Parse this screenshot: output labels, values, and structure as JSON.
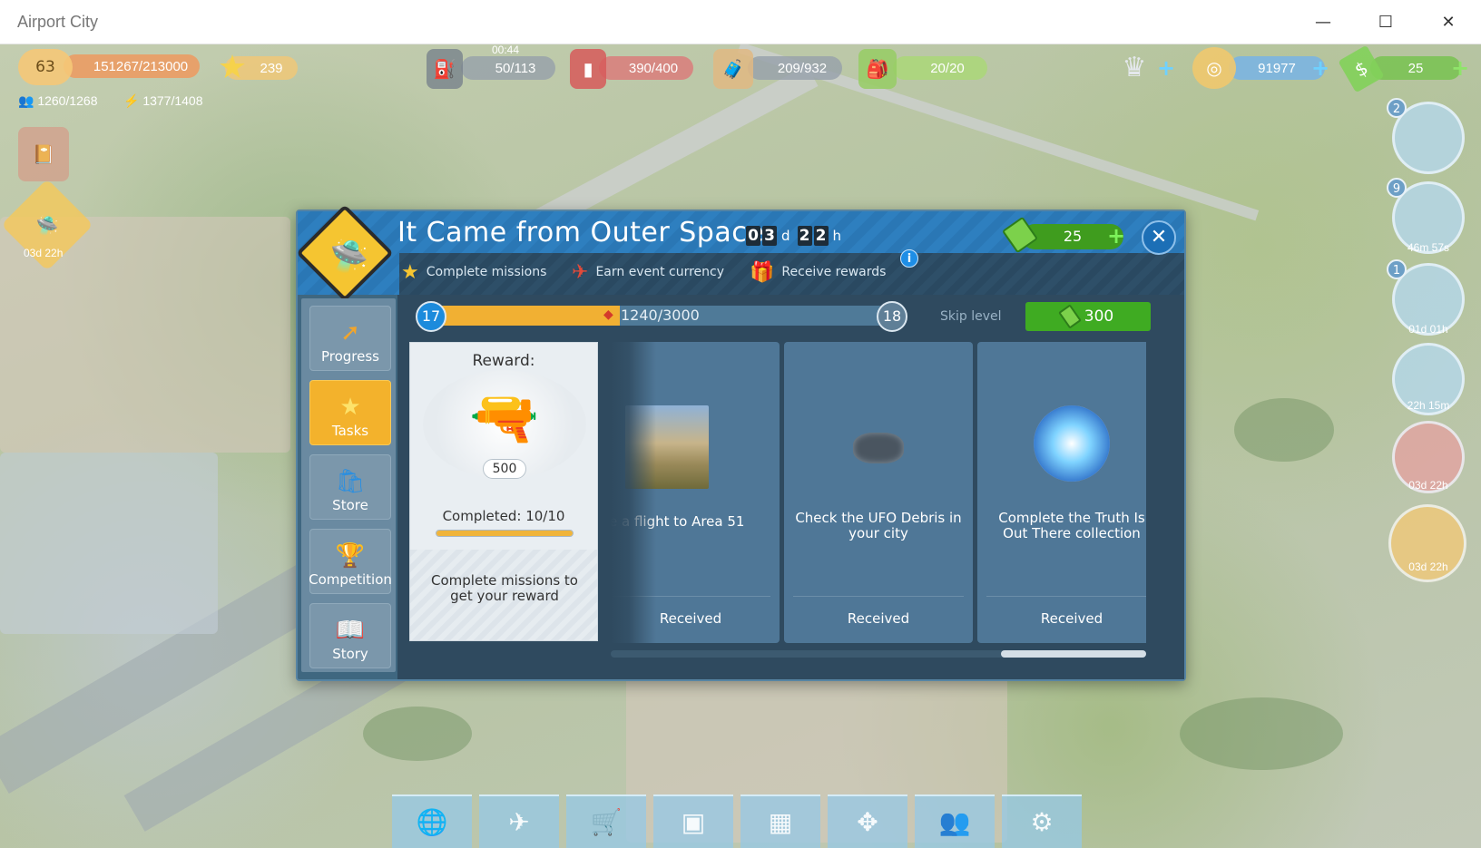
{
  "window": {
    "title": "Airport City",
    "minimize_glyph": "—",
    "maximize_glyph": "☐",
    "close_glyph": "✕"
  },
  "hud": {
    "level": "63",
    "xp": "151267/213000",
    "stars": "239",
    "population": "1260/1268",
    "energy": "1377/1408",
    "fuel_timer": "00:44",
    "fuel": "50/113",
    "gas": "390/400",
    "cargo": "209/932",
    "crew": "20/20",
    "coins": "91977",
    "bills": "25"
  },
  "side_buttons": [
    {
      "name": "control-tower",
      "badge": "2",
      "time": ""
    },
    {
      "name": "radar",
      "badge": "9",
      "time": "46m 57s"
    },
    {
      "name": "speedometer",
      "badge": "1",
      "time": "01d 01h"
    },
    {
      "name": "hotel",
      "badge": "",
      "time": "22h 15m"
    },
    {
      "name": "building-event",
      "badge": "",
      "time": "03d 22h"
    },
    {
      "name": "golden-ticket",
      "badge": "",
      "time": "03d 22h"
    }
  ],
  "left_event_timer": "03d 22h",
  "dialog": {
    "title": "It Came from Outer Space",
    "timer": {
      "d1": "0",
      "d2": "3",
      "unit_days": "d",
      "h1": "2",
      "h2": "2",
      "unit_hours": "h"
    },
    "currency": "25",
    "close_glyph": "✕",
    "info_glyph": "i",
    "steps": [
      "Complete missions",
      "Earn event currency",
      "Receive rewards"
    ],
    "nav": [
      {
        "label": "Progress",
        "icon": "progress-arrow-icon",
        "active": false
      },
      {
        "label": "Tasks",
        "icon": "star-icon",
        "active": true
      },
      {
        "label": "Store",
        "icon": "shopping-bag-icon",
        "active": false
      },
      {
        "label": "Competition",
        "icon": "trophy-icon",
        "active": false
      },
      {
        "label": "Story",
        "icon": "book-icon",
        "active": false
      }
    ],
    "level": {
      "current": "17",
      "next": "18",
      "progress_text": "1240/3000",
      "progress_fraction": 0.4133,
      "skip_label": "Skip level",
      "skip_cost": "300"
    },
    "reward": {
      "title": "Reward:",
      "amount": "500",
      "completed": "Completed: 10/10",
      "completed_fraction": 1.0,
      "description": "Complete missions to get your reward"
    },
    "missions": [
      {
        "text": "e a flight to Area 51",
        "status": "Received",
        "image": "area51-sign-photo"
      },
      {
        "text": "Check the UFO Debris in your city",
        "status": "Received",
        "image": "ufo-debris-icon"
      },
      {
        "text": "Complete the Truth Is Out There collection",
        "status": "Received",
        "image": "portal-icon"
      }
    ],
    "scroll_fraction": 1.0
  },
  "toolbar": [
    {
      "name": "world-map",
      "glyph": "🌐"
    },
    {
      "name": "hangar",
      "glyph": "✈"
    },
    {
      "name": "shop-cart",
      "glyph": "🛒"
    },
    {
      "name": "crate",
      "glyph": "▣"
    },
    {
      "name": "treasure-chest",
      "glyph": "▦"
    },
    {
      "name": "move-tool",
      "glyph": "✥"
    },
    {
      "name": "friends",
      "glyph": "👥"
    },
    {
      "name": "settings",
      "glyph": "⚙"
    }
  ]
}
